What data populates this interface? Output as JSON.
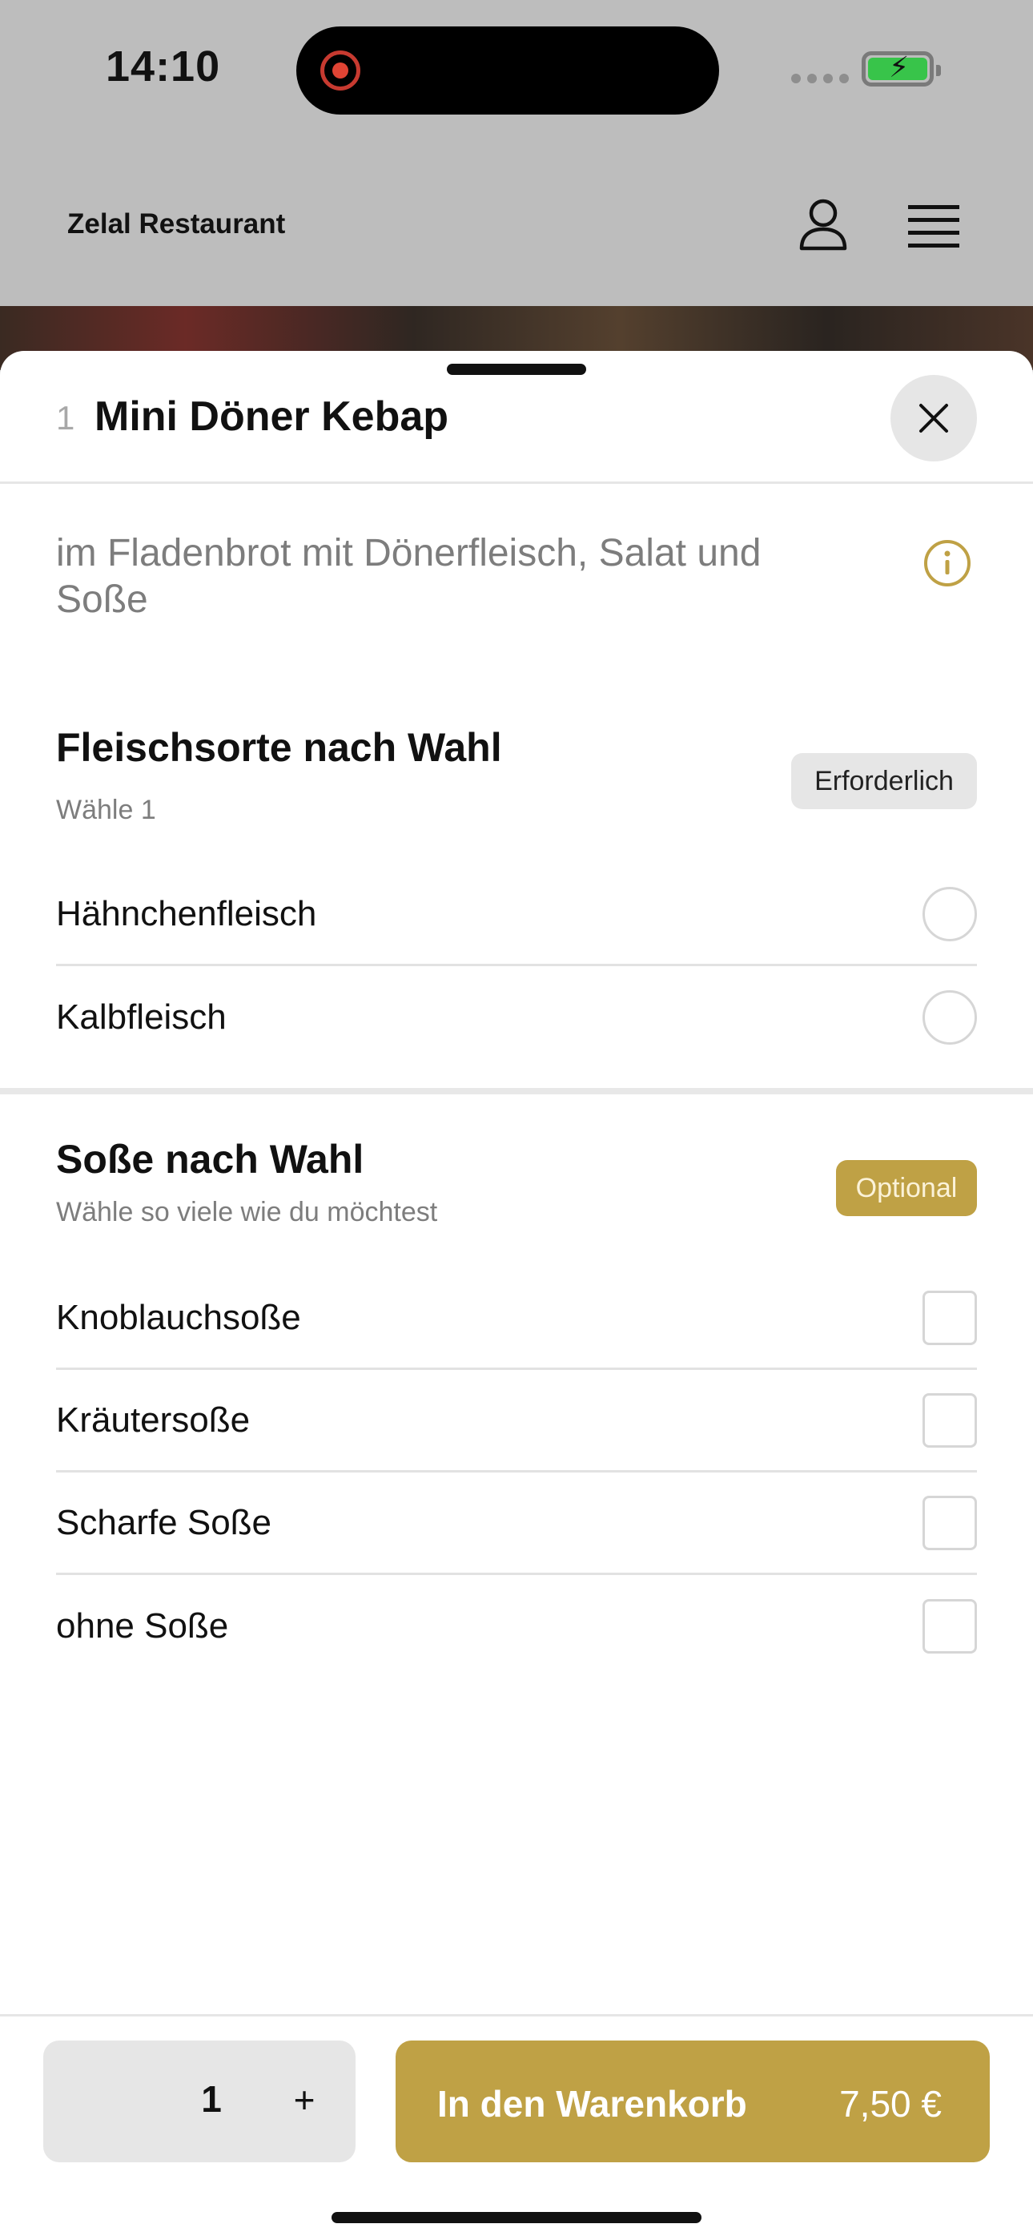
{
  "status_bar": {
    "time": "14:10"
  },
  "header": {
    "restaurant_name": "Zelal Restaurant"
  },
  "sheet": {
    "item_index": "1",
    "item_title": "Mini Döner Kebap",
    "description": "im Fladenbrot mit Dönerfleisch, Salat und Soße",
    "groups": [
      {
        "title": "Fleischsorte nach Wahl",
        "subtitle": "Wähle 1",
        "badge": "Erforderlich",
        "options": [
          "Hähnchenfleisch",
          "Kalbfleisch"
        ]
      },
      {
        "title": "Soße nach Wahl",
        "subtitle": "Wähle so viele wie du möchtest",
        "badge": "Optional",
        "options": [
          "Knoblauchsoße",
          "Kräutersoße",
          "Scharfe Soße",
          "ohne Soße"
        ]
      }
    ]
  },
  "bottom_bar": {
    "quantity": "1",
    "plus": "+",
    "add_label": "In den Warenkorb",
    "price": "7,50 €"
  },
  "colors": {
    "accent": "#bfa145",
    "badge_grey": "#e6e6e6",
    "backdrop": "#bdbdbd"
  },
  "icons": [
    "record-icon",
    "battery-icon",
    "profile-icon",
    "hamburger-menu-icon",
    "close-icon",
    "info-icon"
  ]
}
